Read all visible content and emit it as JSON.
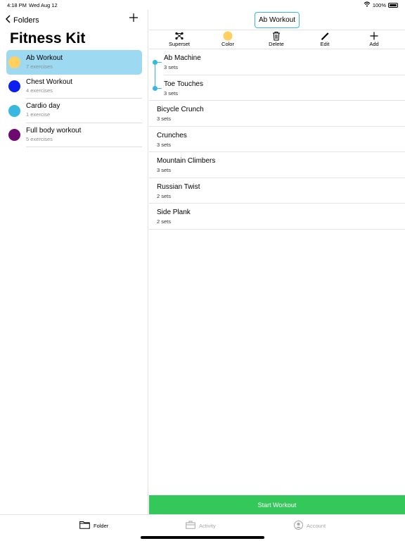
{
  "status_bar": {
    "time": "4:18 PM",
    "date": "Wed Aug 12",
    "battery": "100%"
  },
  "sidebar": {
    "back_label": "Folders",
    "title": "Fitness Kit",
    "folders": [
      {
        "name": "Ab Workout",
        "count": "7 exercises",
        "color": "#ffd060",
        "selected": true
      },
      {
        "name": "Chest Workout",
        "count": "4 exercises",
        "color": "#0a1ff0",
        "selected": false
      },
      {
        "name": "Cardio day",
        "count": "1 exercise",
        "color": "#38b8e0",
        "selected": false
      },
      {
        "name": "Full body workout",
        "count": "5 exercises",
        "color": "#6e0a6e",
        "selected": false
      }
    ]
  },
  "main": {
    "title": "Ab Workout",
    "toolbar": [
      {
        "label": "Superset",
        "icon": "superset-icon"
      },
      {
        "label": "Color",
        "icon": "color-dot-icon"
      },
      {
        "label": "Delete",
        "icon": "trash-icon"
      },
      {
        "label": "Edit",
        "icon": "pencil-icon"
      },
      {
        "label": "Add",
        "icon": "plus-icon"
      }
    ],
    "exercises": [
      {
        "name": "Ab Machine",
        "sets": "3 sets",
        "superset": true
      },
      {
        "name": "Toe Touches",
        "sets": "3 sets",
        "superset": true
      },
      {
        "name": "Bicycle Crunch",
        "sets": "3 sets",
        "superset": false
      },
      {
        "name": "Crunches",
        "sets": "3 sets",
        "superset": false
      },
      {
        "name": "Mountain Climbers",
        "sets": "3 sets",
        "superset": false
      },
      {
        "name": "Russian Twist",
        "sets": "2 sets",
        "superset": false
      },
      {
        "name": "Side Plank",
        "sets": "2 sets",
        "superset": false
      }
    ],
    "start_label": "Start Workout"
  },
  "tabbar": {
    "tabs": [
      {
        "label": "Folder",
        "icon": "folder-icon",
        "active": true
      },
      {
        "label": "Activity",
        "icon": "briefcase-icon",
        "active": false
      },
      {
        "label": "Account",
        "icon": "account-icon",
        "active": false
      }
    ]
  },
  "colors": {
    "accent": "#38b8e0",
    "selected_bg": "#9ed9f2",
    "start_button": "#34c759",
    "color_swatch": "#ffd060"
  }
}
